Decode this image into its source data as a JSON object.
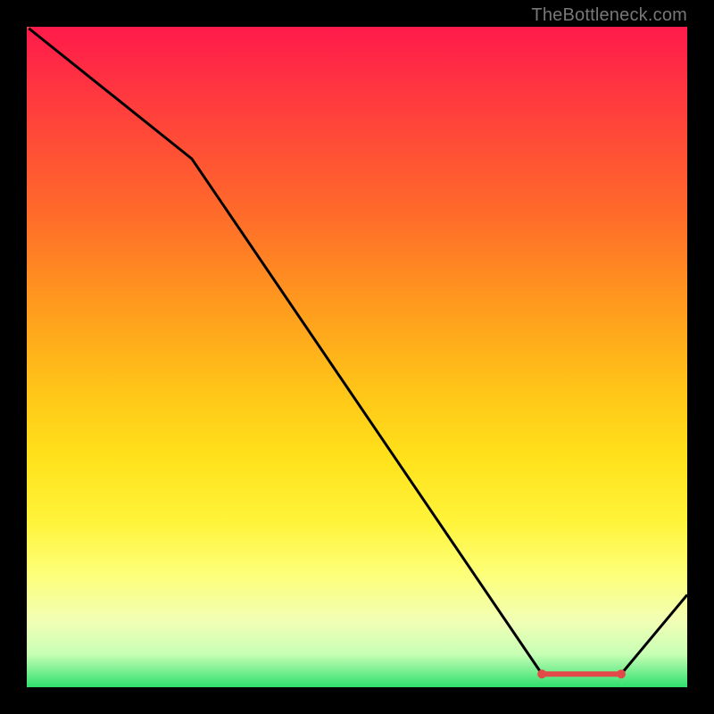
{
  "attribution": "TheBottleneck.com",
  "chart_data": {
    "type": "line",
    "x": [
      0,
      0.25,
      0.78,
      0.9,
      1.0
    ],
    "values": [
      1.0,
      0.8,
      0.02,
      0.02,
      0.14
    ],
    "title": "",
    "xlabel": "",
    "ylabel": "",
    "xlim": [
      0,
      1
    ],
    "ylim": [
      0,
      1
    ],
    "marker_range": {
      "x0": 0.78,
      "x1": 0.9,
      "y": 0.02
    },
    "colors": {
      "line": "#000000",
      "marker": "#e24a4a",
      "gradient_top": "#ff1a4b",
      "gradient_bottom": "#2fdf6e"
    }
  }
}
